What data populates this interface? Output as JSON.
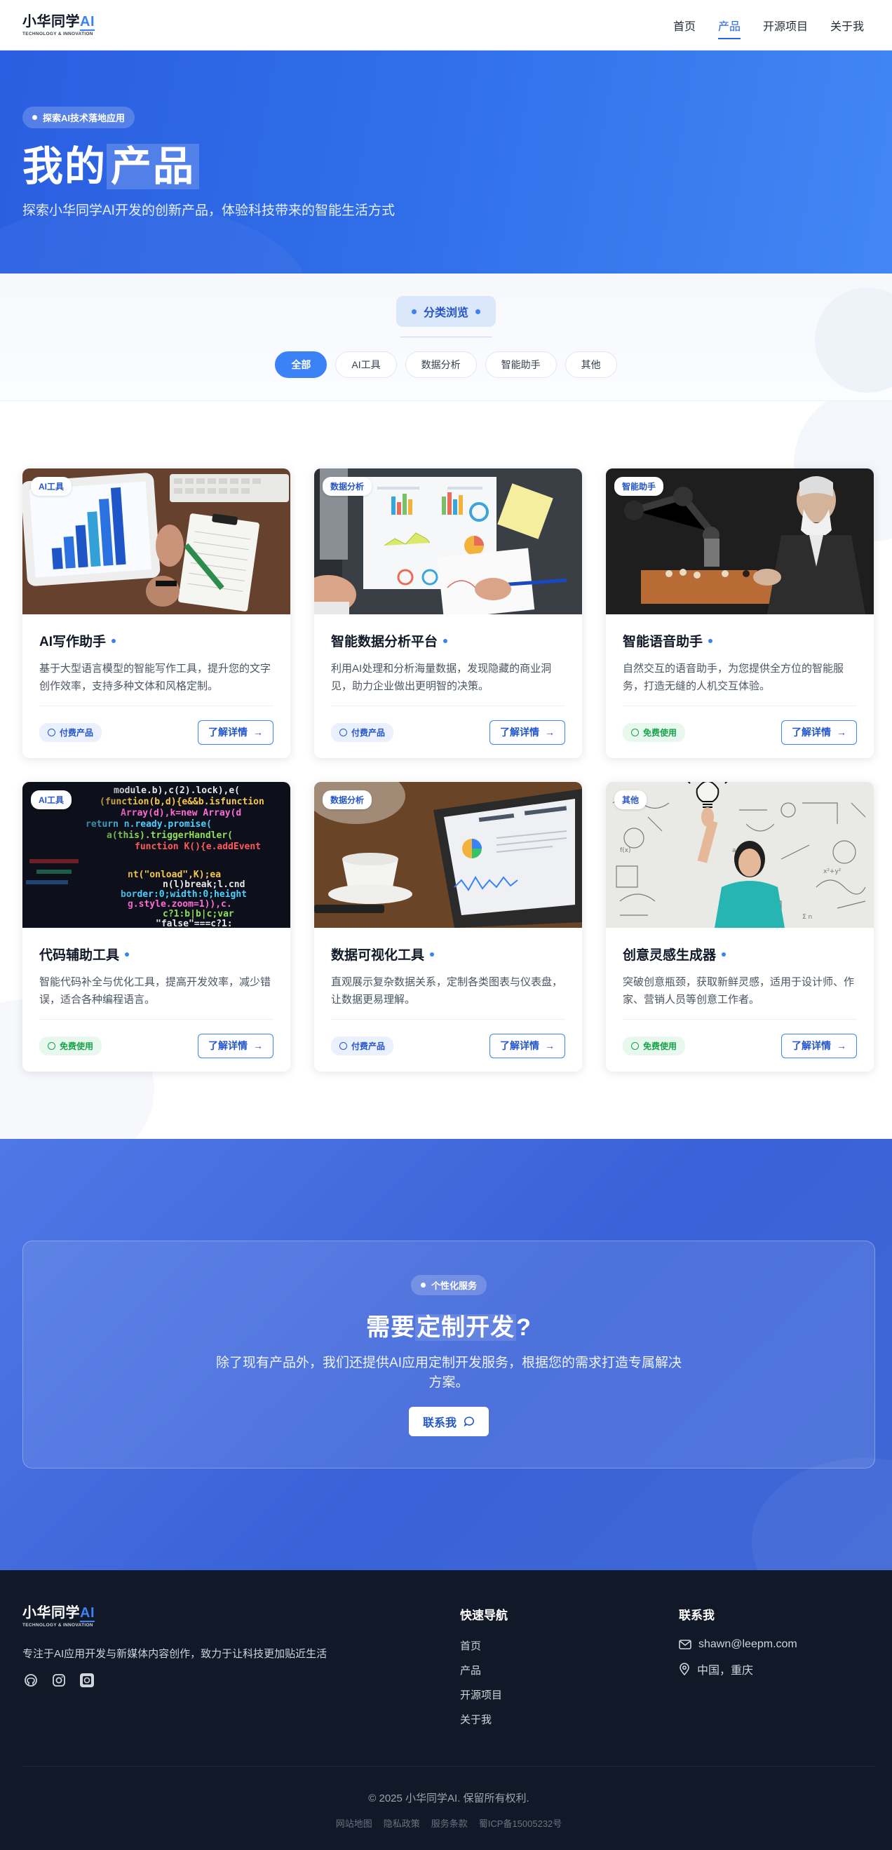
{
  "nav": {
    "logo_main": "小华同学",
    "logo_ai": "AI",
    "logo_sub": "TECHNOLOGY & INNOVATION",
    "links": [
      {
        "label": "首页",
        "active": false
      },
      {
        "label": "产品",
        "active": true
      },
      {
        "label": "开源项目",
        "active": false
      },
      {
        "label": "关于我",
        "active": false
      }
    ]
  },
  "hero": {
    "badge": "探索AI技术落地应用",
    "title_a": "我的",
    "title_b": "产品",
    "subtitle": "探索小华同学AI开发的创新产品，体验科技带来的智能生活方式"
  },
  "filter": {
    "badge": "分类浏览",
    "tabs": [
      "全部",
      "AI工具",
      "数据分析",
      "智能助手",
      "其他"
    ],
    "active_tab": "全部"
  },
  "products": [
    {
      "tag": "AI工具",
      "title": "AI写作助手",
      "desc": "基于大型语言模型的智能写作工具，提升您的文字创作效率，支持多种文体和风格定制。",
      "price": "付费产品",
      "price_type": "paid",
      "button": "了解详情",
      "image": "tablet-chart-notepad"
    },
    {
      "tag": "数据分析",
      "title": "智能数据分析平台",
      "desc": "利用AI处理和分析海量数据，发现隐藏的商业洞见，助力企业做出更明智的决策。",
      "price": "付费产品",
      "price_type": "paid",
      "button": "了解详情",
      "image": "desk-reports-charts"
    },
    {
      "tag": "智能助手",
      "title": "智能语音助手",
      "desc": "自然交互的语音助手，为您提供全方位的智能服务，打造无缝的人机交互体验。",
      "price": "免费使用",
      "price_type": "free",
      "button": "了解详情",
      "image": "robot-chess"
    },
    {
      "tag": "AI工具",
      "title": "代码辅助工具",
      "desc": "智能代码补全与优化工具，提高开发效率，减少错误，适合各种编程语言。",
      "price": "免费使用",
      "price_type": "free",
      "button": "了解详情",
      "image": "code-screen"
    },
    {
      "tag": "数据分析",
      "title": "数据可视化工具",
      "desc": "直观展示复杂数据关系，定制各类图表与仪表盘，让数据更易理解。",
      "price": "付费产品",
      "price_type": "paid",
      "button": "了解详情",
      "image": "tablet-dashboard"
    },
    {
      "tag": "其他",
      "title": "创意灵感生成器",
      "desc": "突破创意瓶颈，获取新鲜灵感，适用于设计师、作家、营销人员等创意工作者。",
      "price": "免费使用",
      "price_type": "free",
      "button": "了解详情",
      "image": "woman-whiteboard-bulb"
    }
  ],
  "cta": {
    "badge": "个性化服务",
    "title_a": "需要",
    "title_b": "定制开发",
    "title_c": "?",
    "desc": "除了现有产品外，我们还提供AI应用定制开发服务，根据您的需求打造专属解决方案。",
    "button": "联系我"
  },
  "footer": {
    "tagline": "专注于AI应用开发与新媒体内容创作，致力于让科技更加贴近生活",
    "quick_nav_title": "快速导航",
    "quick_nav": [
      "首页",
      "产品",
      "开源项目",
      "关于我"
    ],
    "contact_title": "联系我",
    "email": "shawn@leepm.com",
    "location": "中国，重庆",
    "copyright": "© 2025 小华同学AI. 保留所有权利.",
    "bottom_links": [
      "网站地图",
      "隐私政策",
      "服务条款",
      "蜀ICP备15005232号"
    ]
  },
  "colors": {
    "accent": "#3b82f6",
    "hero_start": "#2a5ee0",
    "footer_bg": "#111827",
    "free": "#16a34a"
  }
}
